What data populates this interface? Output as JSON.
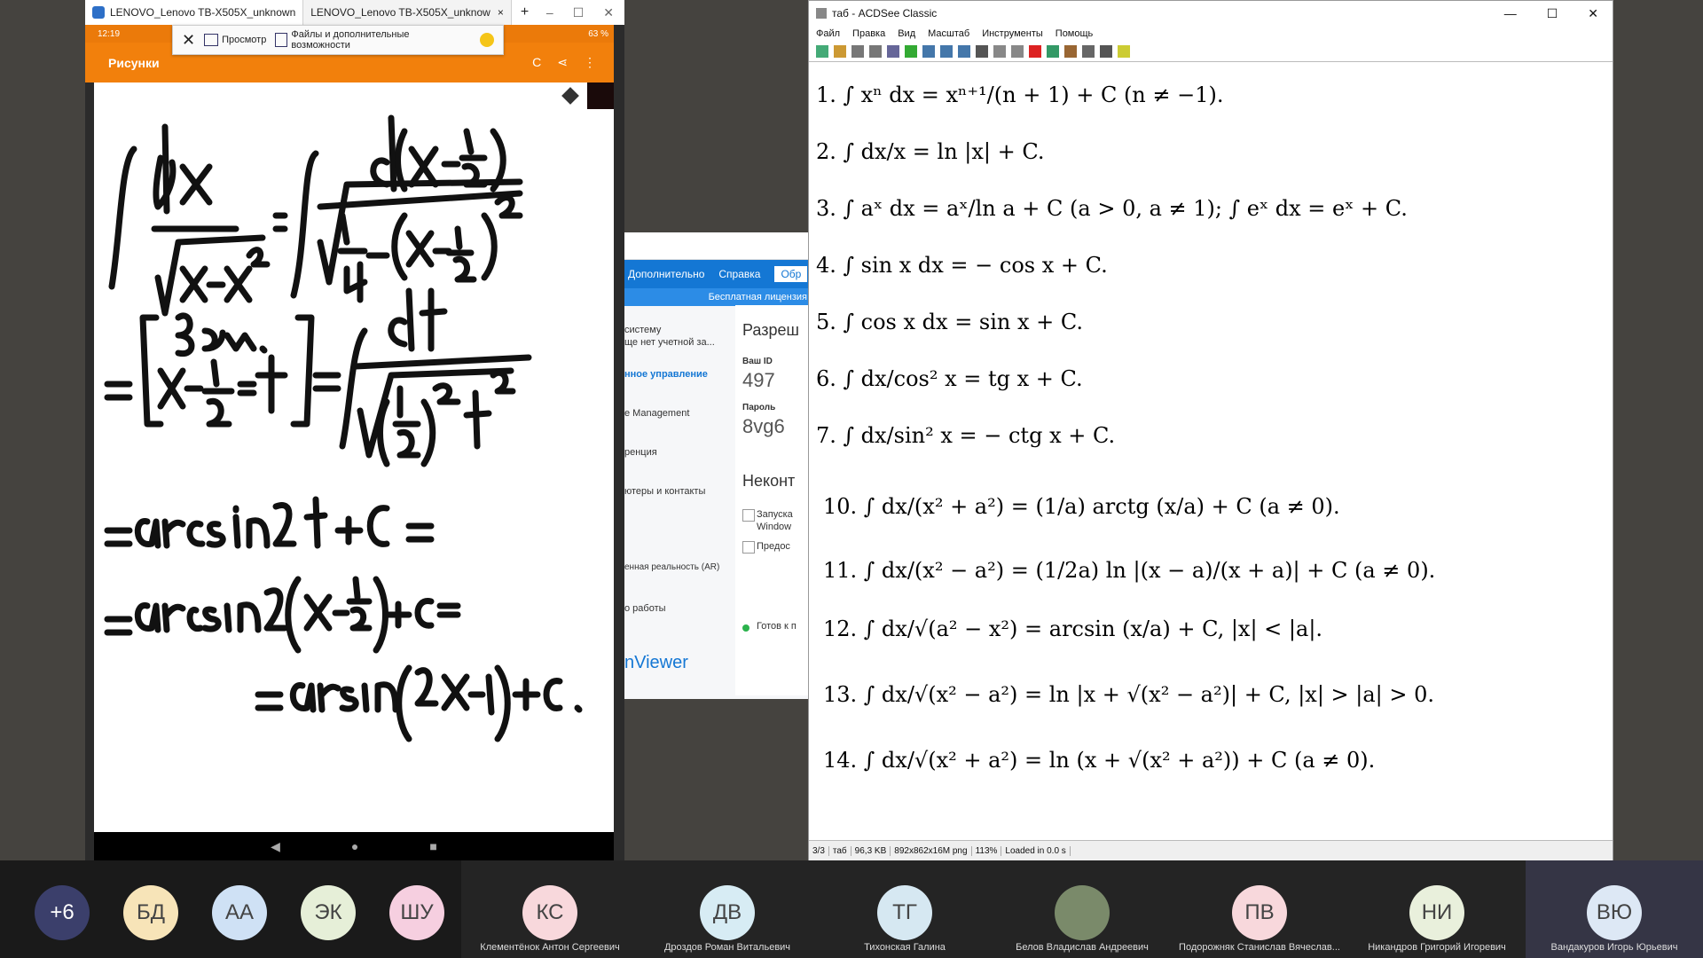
{
  "left_window": {
    "tabs": [
      {
        "label": "LENOVO_Lenovo TB-X505X_unknown"
      },
      {
        "label": "LENOVO_Lenovo TB-X505X_unknow"
      }
    ],
    "new_tab": "+",
    "tab_close": "×",
    "window_buttons": [
      "–",
      "☐",
      "✕"
    ],
    "status_time": "12:19",
    "status_battery": "63 %",
    "remote_toolbar": {
      "view_label": "Просмотр",
      "files_label": "Файлы и дополнительные возможности",
      "close": "✕"
    },
    "app_title": "Рисунки",
    "app_icons": [
      "C",
      "⋖",
      "⋮"
    ],
    "nav": [
      "◀",
      "●",
      "■"
    ]
  },
  "middle_window": {
    "menu": [
      "Дополнительно",
      "Справка",
      "Обр"
    ],
    "license": "Бесплатная лицензия",
    "sidebar": [
      "систему",
      "ще нет учетной за...",
      "нное управление",
      "e Management",
      "ренция",
      "ютеры и контакты",
      "енная реальность (AR)",
      "о работы"
    ],
    "brand": "nViewer",
    "heading": "Разреш",
    "your_id_label": "Ваш ID",
    "your_id_value": "497",
    "password_label": "Пароль",
    "password_value": "8vg6",
    "uncontrolled": "Неконт",
    "checkbox1": "Запуска",
    "checkbox1b": "Window",
    "checkbox2": "Предос",
    "status": "Готов к п"
  },
  "right_window": {
    "title": "таб - ACDSee Classic",
    "window_buttons": [
      "—",
      "☐",
      "✕"
    ],
    "menu": [
      "Файл",
      "Правка",
      "Вид",
      "Масштаб",
      "Инструменты",
      "Помощь"
    ],
    "formulas": [
      "1.  ∫ xⁿ dx = xⁿ⁺¹/(n + 1) + C     (n ≠ −1).",
      "2.  ∫ dx/x = ln |x| + C.",
      "3.  ∫ aˣ dx = aˣ/ln a + C    (a > 0, a ≠ 1);   ∫ eˣ dx = eˣ + C.",
      "4.  ∫ sin x dx = − cos x + C.",
      "5.  ∫ cos x dx = sin x + C.",
      "6.  ∫ dx/cos² x = tg x + C.",
      "7.  ∫ dx/sin² x = − ctg x + C.",
      "10.  ∫ dx/(x² + a²) = (1/a) arctg (x/a) + C    (a ≠ 0).",
      "11.  ∫ dx/(x² − a²) = (1/2a) ln |(x − a)/(x + a)| + C    (a ≠ 0).",
      "12.  ∫ dx/√(a² − x²) = arcsin (x/a) + C,    |x| < |a|.",
      "13.  ∫ dx/√(x² − a²) = ln |x + √(x² − a²)| + C,    |x| > |a| > 0.",
      "14.  ∫ dx/√(x² + a²) = ln (x + √(x² + a²)) + C    (a ≠ 0)."
    ],
    "status": [
      "3/3",
      "таб",
      "96,3 KB",
      "892x862x16M png",
      "113%",
      "Loaded in 0.0 s"
    ]
  },
  "participants": [
    {
      "initials": "+6",
      "name": "",
      "color": "#3b3f6b"
    },
    {
      "initials": "БД",
      "name": "",
      "color": "#f7e4b8"
    },
    {
      "initials": "АА",
      "name": "",
      "color": "#cfe1f5"
    },
    {
      "initials": "ЭК",
      "name": "",
      "color": "#e6efd8"
    },
    {
      "initials": "ШУ",
      "name": "",
      "color": "#f6cfe0"
    },
    {
      "initials": "КС",
      "name": "Клементёнок Антон Сергеевич",
      "color": "#f8d8dc"
    },
    {
      "initials": "ДВ",
      "name": "Дроздов Роман Витальевич",
      "color": "#d7ecf4"
    },
    {
      "initials": "ТГ",
      "name": "Тихонская Галина",
      "color": "#d6e8f2"
    },
    {
      "initials": "",
      "name": "Белов Владислав Андреевич",
      "color": "#7a8a6a"
    },
    {
      "initials": "ПВ",
      "name": "Подорожняк Станислав Вячеслав...",
      "color": "#f8d8dc"
    },
    {
      "initials": "НИ",
      "name": "Никандров Григорий Игоревич",
      "color": "#e9f0dc"
    },
    {
      "initials": "ВЮ",
      "name": "Вандакуров Игорь Юрьевич",
      "color": "#dde8f5"
    }
  ]
}
